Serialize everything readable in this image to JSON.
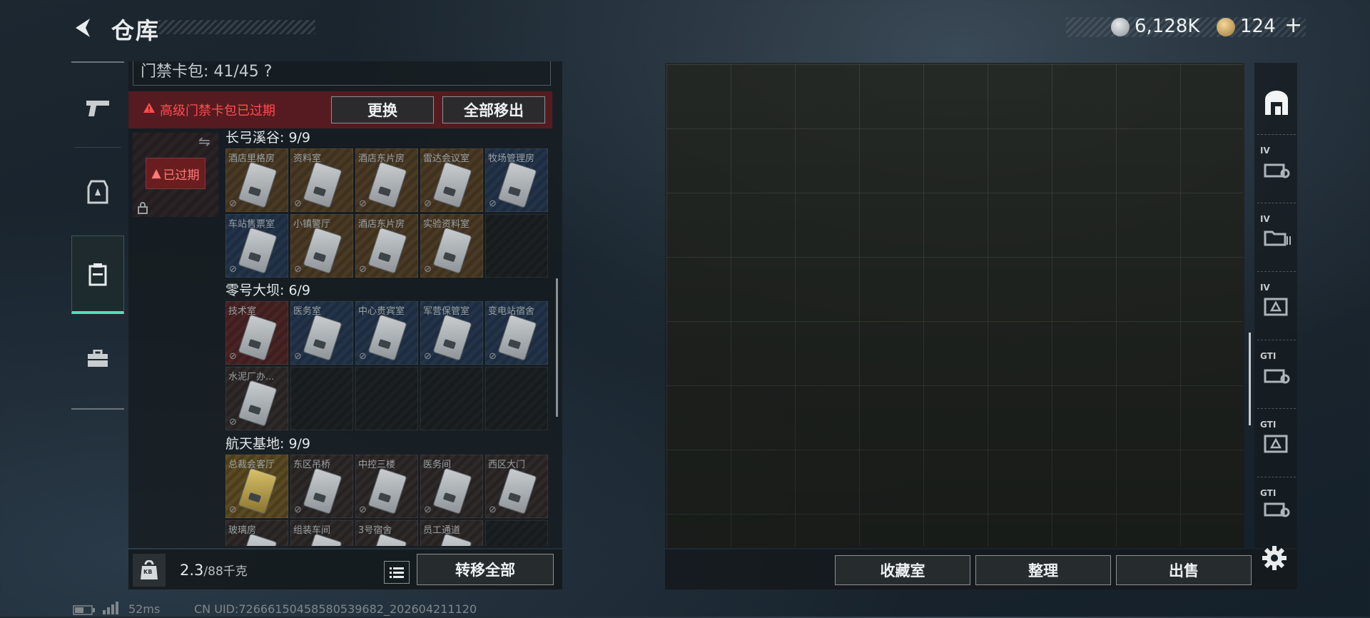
{
  "header": {
    "title": "仓库",
    "silver_amount": "6,128K",
    "gold_amount": "124",
    "plus": "+"
  },
  "panel": {
    "keycard_count": "门禁卡包: 41/45 ?",
    "warning": "高级门禁卡包已过期",
    "replace_label": "更换",
    "remove_all_label": "全部移出",
    "expired_label": "已过期",
    "groups": [
      {
        "label": "长弓溪谷: 9/9",
        "cells": [
          {
            "name": "酒店里格房",
            "tint": "orange"
          },
          {
            "name": "资料室",
            "tint": "orange"
          },
          {
            "name": "酒店东片房",
            "tint": "orange"
          },
          {
            "name": "雷达会议室",
            "tint": "orange"
          },
          {
            "name": "牧场管理房",
            "tint": "blue"
          },
          {
            "name": "车站售票室",
            "tint": "blue"
          },
          {
            "name": "小镇警厅",
            "tint": "orange"
          },
          {
            "name": "酒店东片房",
            "tint": "orange"
          },
          {
            "name": "实验资料室",
            "tint": "orange"
          }
        ]
      },
      {
        "label": "零号大坝: 6/9",
        "cells": [
          {
            "name": "技术室",
            "tint": "red"
          },
          {
            "name": "医务室",
            "tint": "blue"
          },
          {
            "name": "中心贵宾室",
            "tint": "blue"
          },
          {
            "name": "军营保管室",
            "tint": "blue"
          },
          {
            "name": "变电站宿舍",
            "tint": "blue"
          },
          {
            "name": "水泥厂办...",
            "tint": "plain"
          }
        ]
      },
      {
        "label": "航天基地: 9/9",
        "cells": [
          {
            "name": "总裁会客厅",
            "tint": "gold"
          },
          {
            "name": "东区吊桥",
            "tint": "plain"
          },
          {
            "name": "中控三楼",
            "tint": "plain"
          },
          {
            "name": "医务间",
            "tint": "plain"
          },
          {
            "name": "西区大门",
            "tint": "plain"
          },
          {
            "name": "玻璃房",
            "tint": "plain"
          },
          {
            "name": "组装车间",
            "tint": "plain"
          },
          {
            "name": "3号宿舍",
            "tint": "plain"
          },
          {
            "name": "员工通道",
            "tint": "plain"
          }
        ]
      }
    ],
    "weight_value": "2.3",
    "weight_max": "/88千克",
    "bag_label": "KB",
    "transfer_all_label": "转移全部"
  },
  "right_rail": {
    "tiers": [
      "IV",
      "IV",
      "IV",
      "GTI",
      "GTI",
      "GTI"
    ]
  },
  "bottom_right": {
    "collection_label": "收藏室",
    "sort_label": "整理",
    "sell_label": "出售"
  },
  "footer": {
    "latency": "52ms",
    "uid": "CN UID:7266615045858053968​2_202604211120"
  },
  "colors": {
    "accent": "#4fe0b8",
    "warning": "#ff4d4d"
  }
}
